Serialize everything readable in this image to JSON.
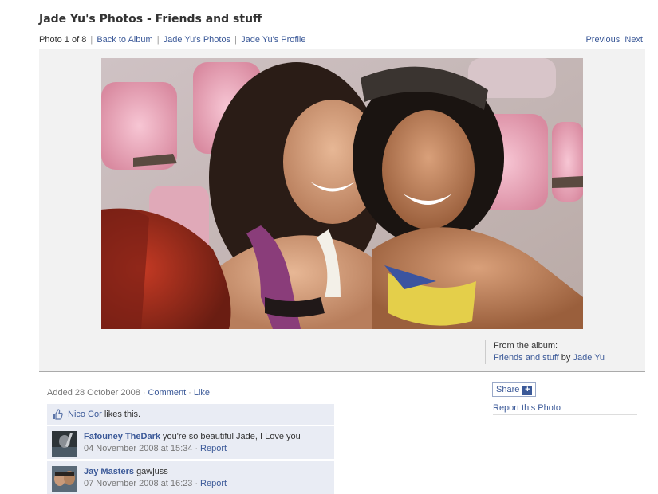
{
  "header": {
    "title": "Jade Yu's Photos - Friends and stuff"
  },
  "nav": {
    "position": "Photo 1 of 8",
    "back_to_album": "Back to Album",
    "user_photos": "Jade Yu's Photos",
    "user_profile": "Jade Yu's Profile",
    "previous": "Previous",
    "next": "Next"
  },
  "album_info": {
    "label": "From the album:",
    "album_name": "Friends and stuff",
    "by": "by",
    "owner": "Jade Yu"
  },
  "meta": {
    "added": "Added 28 October 2008",
    "comment": "Comment",
    "like": "Like"
  },
  "likes": {
    "name": "Nico Cor",
    "text": "likes this."
  },
  "comments": [
    {
      "name": "Fafouney TheDark",
      "text": "you're so beautiful Jade, I Love you",
      "time": "04 November 2008 at 15:34",
      "report": "Report"
    },
    {
      "name": "Jay Masters",
      "text": "gawjuss",
      "time": "07 November 2008 at 16:23",
      "report": "Report"
    }
  ],
  "actions": {
    "share": "Share",
    "report_photo": "Report this Photo"
  },
  "colors": {
    "link": "#3b5998",
    "comment_bg": "#e9ecf4"
  }
}
